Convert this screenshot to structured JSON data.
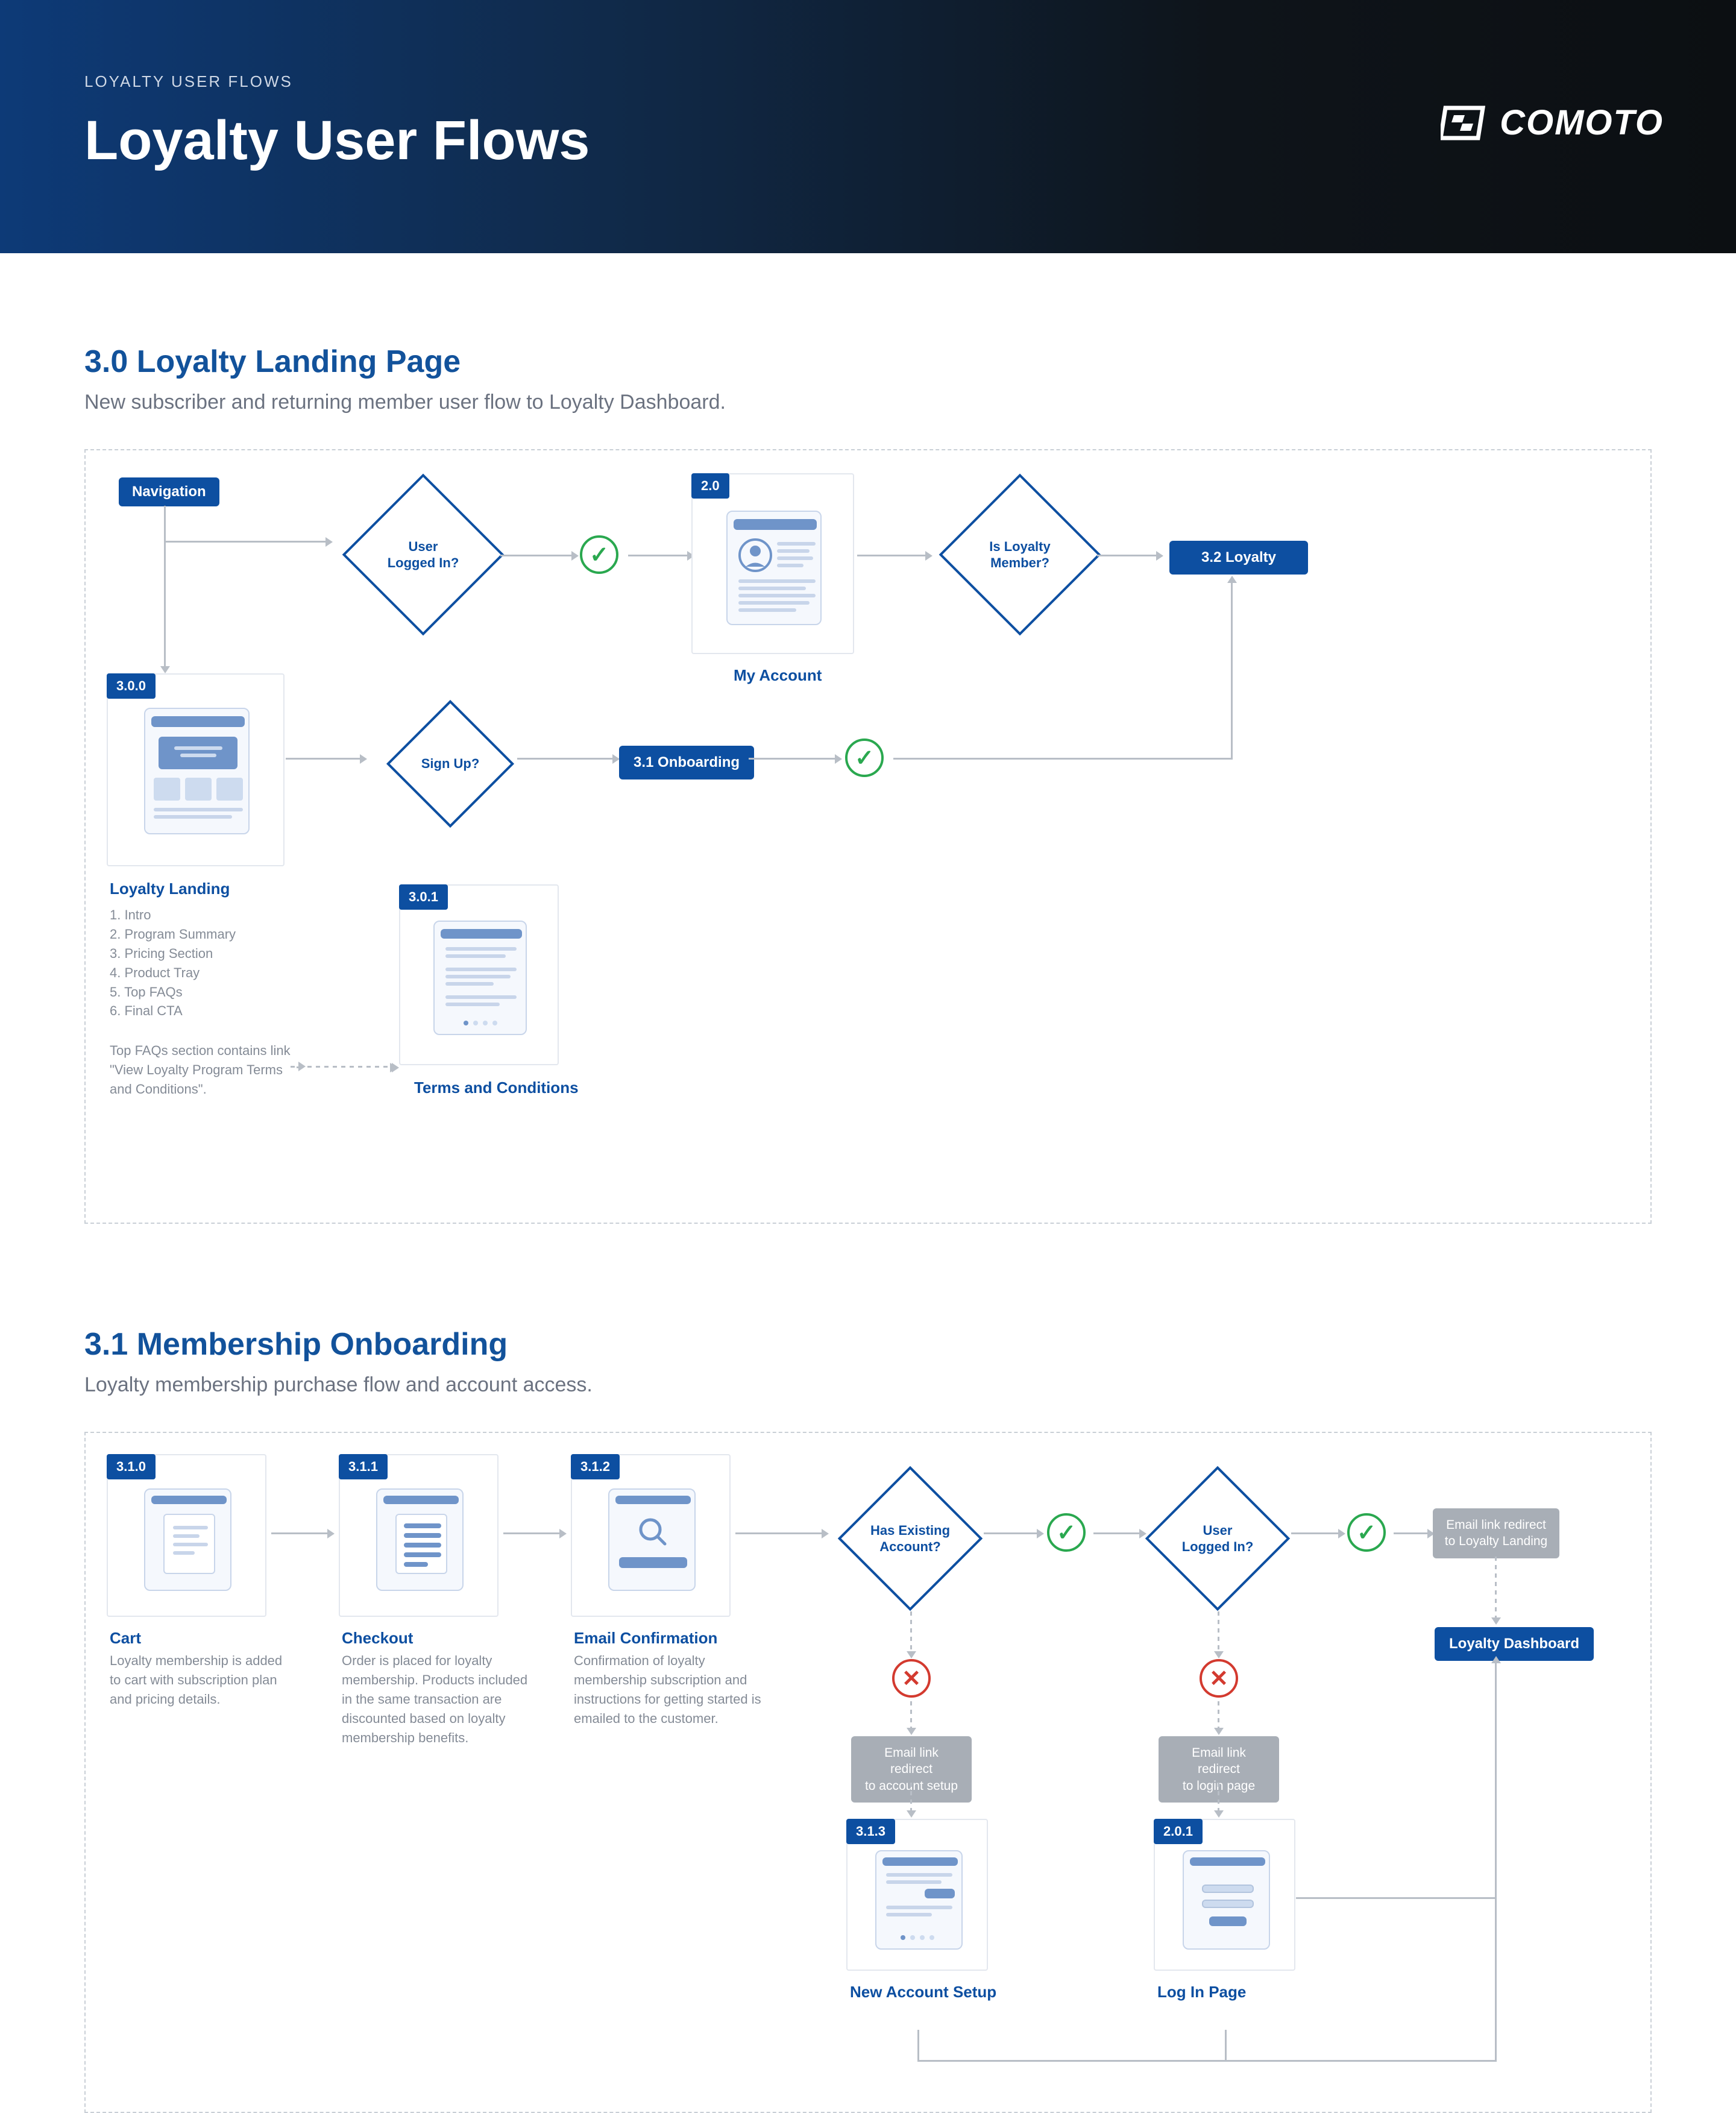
{
  "header": {
    "breadcrumb": "LOYALTY USER FLOWS",
    "title": "Loyalty User Flows",
    "brand": "COMOTO"
  },
  "section1": {
    "title": "3.0 Loyalty Landing Page",
    "subtitle": "New subscriber and returning member user flow to Loyalty Dashboard.",
    "nodes": {
      "nav_chip": "Navigation",
      "d_logged_in": "User\nLogged In?",
      "card_myaccount": {
        "badge": "2.0",
        "title": "My Account"
      },
      "d_is_member": "Is Loyalty\nMember?",
      "chip_loyalty": "3.2 Loyalty",
      "card_landing": {
        "badge": "3.0.0",
        "title": "Loyalty Landing",
        "list": "1. Intro\n2. Program Summary\n3. Pricing Section\n4. Product Tray\n5. Top FAQs\n6. Final CTA",
        "note": "Top FAQs section contains link \"View Loyalty Program Terms and Conditions\"."
      },
      "d_signup": "Sign Up?",
      "chip_onboarding": "3.1 Onboarding",
      "card_terms": {
        "badge": "3.0.1",
        "title": "Terms and Conditions"
      }
    }
  },
  "section2": {
    "title": "3.1 Membership Onboarding",
    "subtitle": "Loyalty membership purchase flow and account access.",
    "nodes": {
      "c_cart": {
        "badge": "3.1.0",
        "title": "Cart",
        "desc": "Loyalty membership is added to cart with subscription plan and pricing details."
      },
      "c_checkout": {
        "badge": "3.1.1",
        "title": "Checkout",
        "desc": "Order is placed for loyalty membership. Products included in the same transaction are discounted based on loyalty membership benefits."
      },
      "c_email": {
        "badge": "3.1.2",
        "title": "Email Confirmation",
        "desc": "Confirmation of loyalty membership subscription and instructions for getting started is emailed to the customer."
      },
      "d_has_acct": "Has Existing\nAccount?",
      "d_logged_in": "User\nLogged In?",
      "g_to_landing": "Email link redirect\nto Loyalty Landing",
      "g_to_acct": "Email link redirect\nto account setup",
      "g_to_login": "Email link redirect\nto login page",
      "c_new_acct": {
        "badge": "3.1.3",
        "title": "New Account Setup"
      },
      "c_login": {
        "badge": "2.0.1",
        "title": "Log In Page"
      },
      "chip_dash": "Loyalty Dashboard"
    }
  }
}
